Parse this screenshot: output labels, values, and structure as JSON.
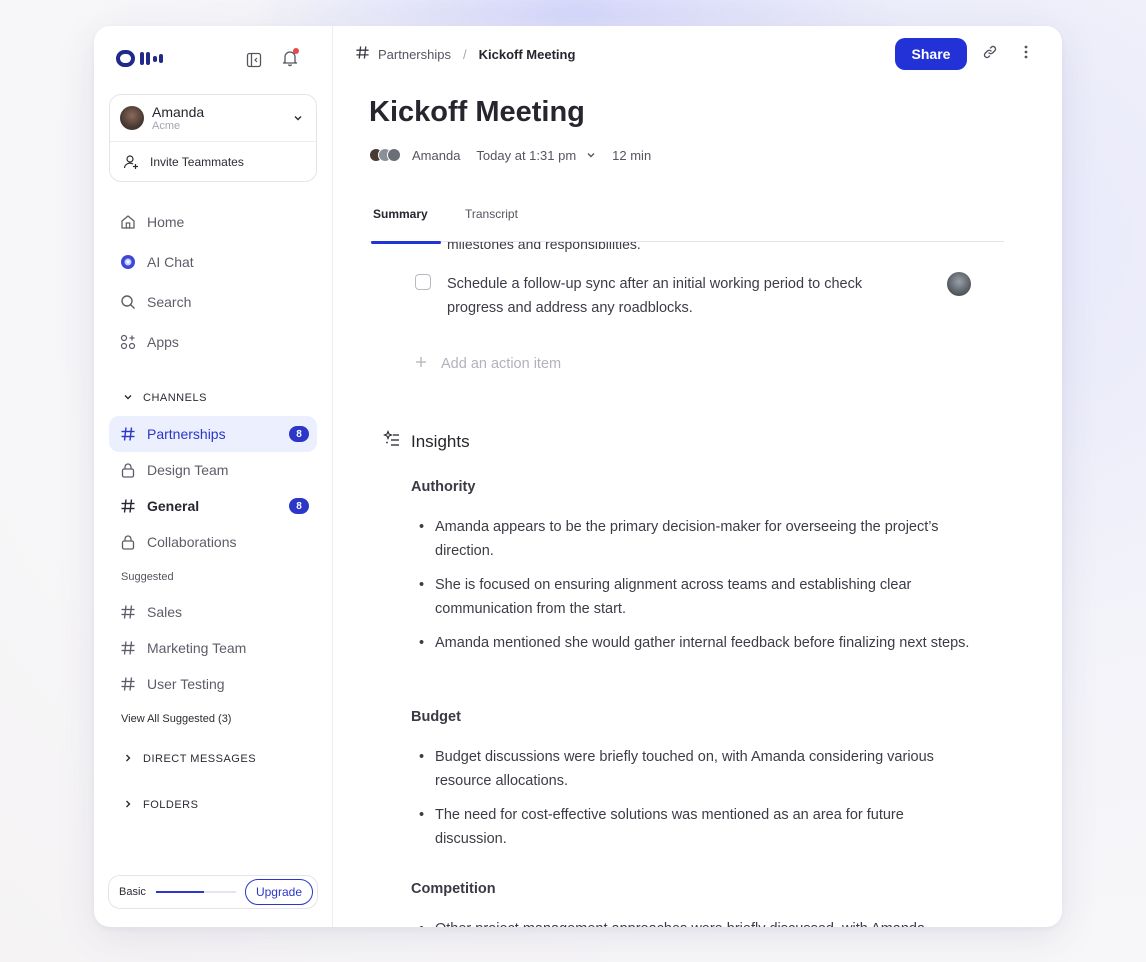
{
  "app": {
    "logo_text": "Otter"
  },
  "sidebar": {
    "user": {
      "name": "Amanda",
      "org": "Acme"
    },
    "invite_label": "Invite Teammates",
    "nav": [
      {
        "label": "Home",
        "icon": "home-icon"
      },
      {
        "label": "AI Chat",
        "icon": "ai-chat-icon"
      },
      {
        "label": "Search",
        "icon": "search-icon"
      },
      {
        "label": "Apps",
        "icon": "apps-icon"
      }
    ],
    "channels_label": "CHANNELS",
    "channels": [
      {
        "label": "Partnerships",
        "icon": "hash-icon",
        "badge": "8",
        "active": true
      },
      {
        "label": "Design Team",
        "icon": "lock-icon"
      },
      {
        "label": "General",
        "icon": "hash-icon",
        "badge": "8"
      },
      {
        "label": "Collaborations",
        "icon": "lock-icon"
      }
    ],
    "suggested_label": "Suggested",
    "suggested": [
      {
        "label": "Sales",
        "icon": "hash-icon"
      },
      {
        "label": "Marketing Team",
        "icon": "hash-icon"
      },
      {
        "label": "User Testing",
        "icon": "hash-icon"
      }
    ],
    "view_all_label": "View All Suggested (3)",
    "direct_messages_label": "DIRECT MESSAGES",
    "folders_label": "FOLDERS",
    "plan": {
      "label": "Basic",
      "progress": 0.6,
      "upgrade_label": "Upgrade"
    }
  },
  "header": {
    "breadcrumb_parent": "Partnerships",
    "breadcrumb_separator": "/",
    "breadcrumb_current": "Kickoff Meeting",
    "share_label": "Share"
  },
  "meeting": {
    "title": "Kickoff Meeting",
    "owner": "Amanda",
    "time": "Today at 1:31 pm",
    "duration": "12 min"
  },
  "tabs": [
    {
      "label": "Summary",
      "active": true
    },
    {
      "label": "Transcript"
    }
  ],
  "summary": {
    "cut_text": "milestones and responsibilities.",
    "action_item": "Schedule a follow-up sync after an initial working period to check progress and address any roadblocks.",
    "add_action_label": "Add an action item",
    "insights_title": "Insights",
    "sections": [
      {
        "title": "Authority",
        "bullets": [
          "Amanda appears to be the primary decision-maker for overseeing the project’s direction.",
          "She is focused on ensuring alignment across teams and establishing clear communication from the start.",
          "Amanda mentioned she would gather internal feedback before finalizing next steps."
        ]
      },
      {
        "title": "Budget",
        "bullets": [
          "Budget discussions were briefly touched on, with Amanda considering various resource allocations.",
          "The need for cost-effective solutions was mentioned as an area for future discussion."
        ]
      },
      {
        "title": "Competition",
        "bullets": [
          "Other project management approaches were briefly discussed, with Amanda exploring different collaboration tools and workflows."
        ]
      }
    ]
  },
  "colors": {
    "accent": "#2332d6",
    "active_bg": "#eceffd",
    "notification_dot": "#e5484d"
  }
}
